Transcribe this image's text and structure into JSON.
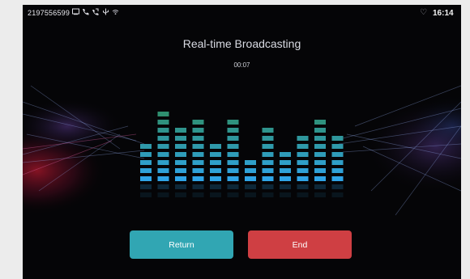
{
  "status_bar": {
    "device_id": "2197556599",
    "icons": [
      "cast-icon",
      "phone-call-icon",
      "phone-forward-icon",
      "usb-icon",
      "wifi-icon"
    ],
    "heart_icon": "heart-outline-icon",
    "time": "16:14"
  },
  "broadcast": {
    "title": "Real-time Broadcasting",
    "elapsed": "00:07"
  },
  "equalizer": {
    "levels": [
      5,
      9,
      7,
      8,
      5,
      8,
      3,
      7,
      4,
      6,
      8,
      6
    ],
    "max_level": 9,
    "top_color": "#2f8f6f",
    "bottom_color": "#2fa4e6"
  },
  "buttons": {
    "return_label": "Return",
    "end_label": "End",
    "return_color": "#31a6b3",
    "end_color": "#cf3f43"
  }
}
